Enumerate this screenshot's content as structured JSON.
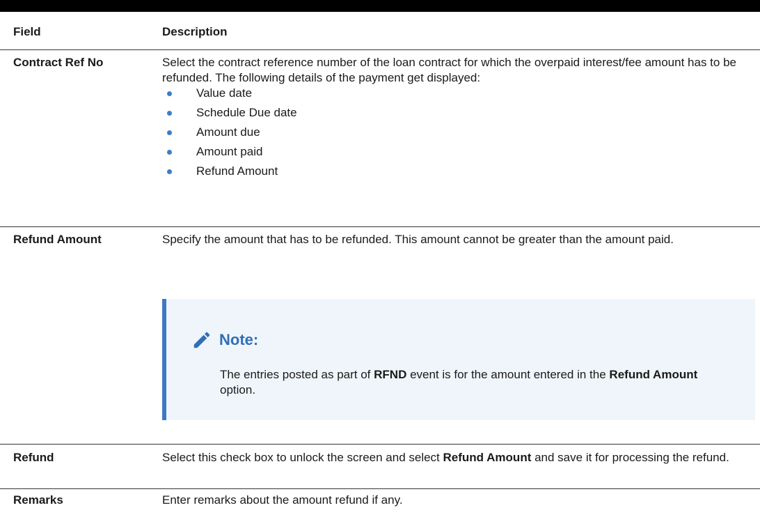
{
  "header": {
    "field": "Field",
    "description": "Description"
  },
  "rows": {
    "contract": {
      "label": "Contract Ref No",
      "text": "Select the contract reference number of the loan contract for which the overpaid interest/fee amount has to be refunded. The following details of the payment get displayed:",
      "bullets": [
        "Value date",
        "Schedule Due date",
        "Amount due",
        "Amount paid",
        "Refund Amount"
      ]
    },
    "refund_amount": {
      "label": "Refund Amount",
      "text": "Specify the amount that has to be refunded. This amount cannot be greater than the amount paid.",
      "note": {
        "title": "Note:",
        "text_1": "The entries posted as part of ",
        "bold_1": "RFND",
        "text_2": " event is for the amount entered in the ",
        "bold_2": "Refund Amount",
        "text_3": " option."
      }
    },
    "refund": {
      "label": "Refund",
      "text_1": "Select this check box to unlock the screen and select ",
      "bold_1": "Refund Amount",
      "text_2": " and save it for processing the refund."
    },
    "remarks": {
      "label": "Remarks",
      "text": "Enter remarks about the amount refund if any."
    }
  },
  "colors": {
    "accent": "#3c7ac2",
    "note_bg": "#f0f5fb",
    "bullet": "#3a7ec7"
  },
  "icons": {
    "note": "pencil-icon"
  }
}
